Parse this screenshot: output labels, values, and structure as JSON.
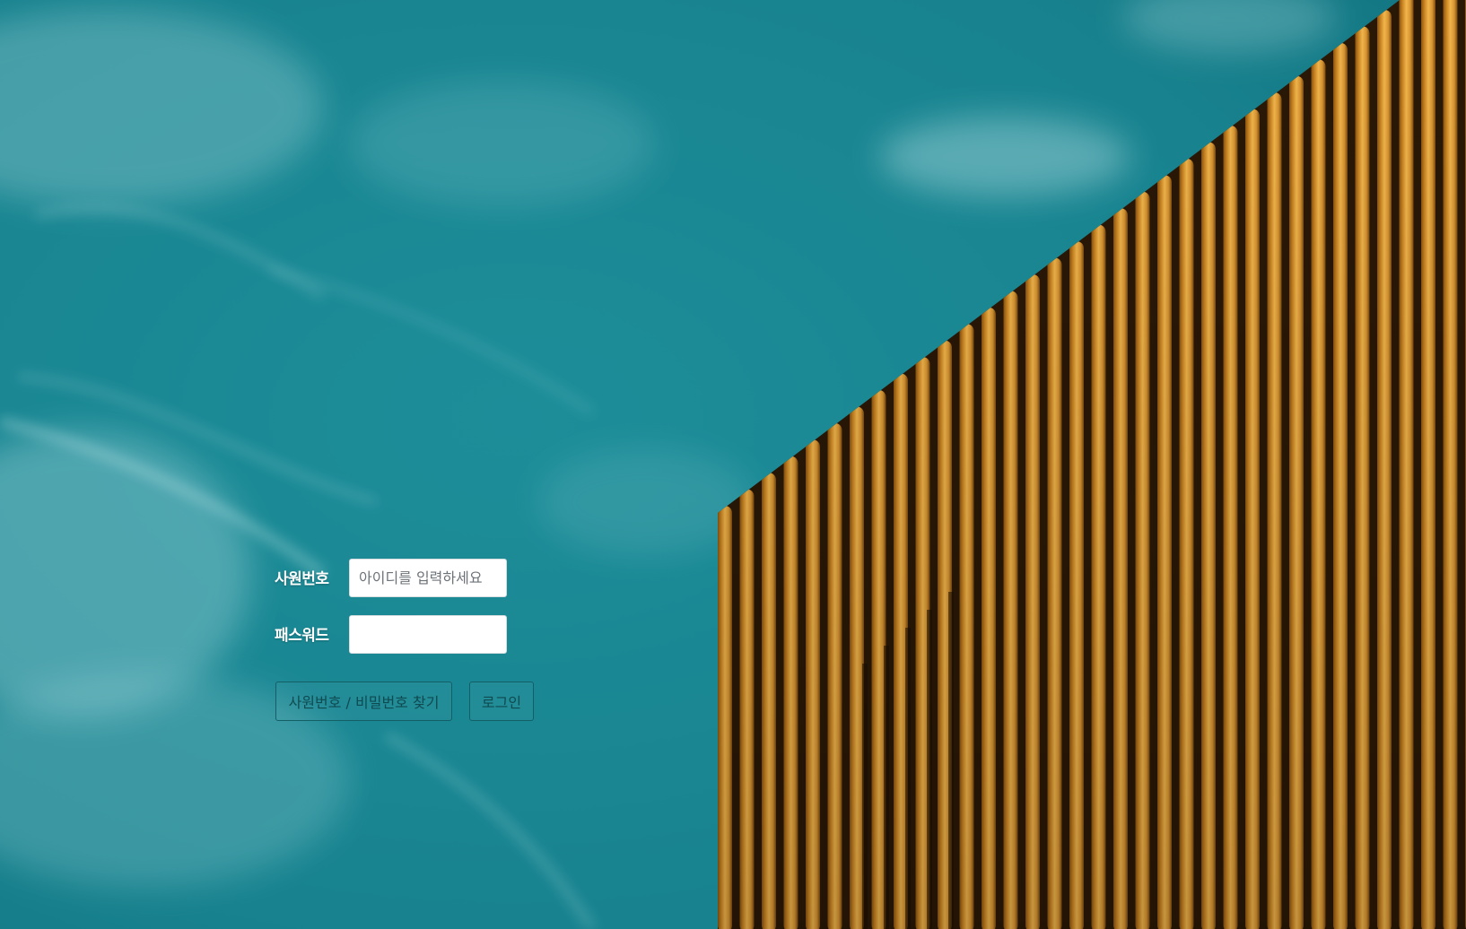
{
  "login": {
    "id_label": "사원번호",
    "id_placeholder": "아이디를 입력하세요",
    "id_value": "",
    "password_label": "패스워드",
    "password_value": "",
    "find_button_label": "사원번호 / 비밀번호 찾기",
    "login_button_label": "로그인"
  },
  "colors": {
    "sky": "#1b8a95",
    "building_gold": "#d9932b",
    "button_border": "#145e66"
  }
}
